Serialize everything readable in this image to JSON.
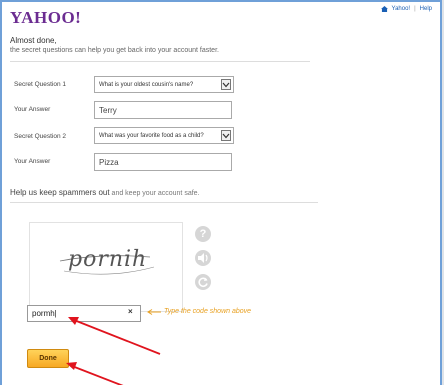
{
  "header": {
    "logo": "YAHOO!",
    "links": [
      "Yahoo!",
      "Help"
    ]
  },
  "intro": {
    "title": "Almost done,",
    "subtitle": "the secret questions can help you get back into your account faster."
  },
  "form": {
    "q1_label": "Secret Question 1",
    "q1_value": "What is your oldest cousin's name?",
    "a1_label": "Your Answer",
    "a1_value": "Terry",
    "q2_label": "Secret Question 2",
    "q2_value": "What was your favorite food as a child?",
    "a2_label": "Your Answer",
    "a2_value": "Pizza"
  },
  "spam": {
    "title": "Help us keep spammers out",
    "title_rest": " and keep your account safe."
  },
  "captcha": {
    "word": "pornih",
    "icons": [
      "help-icon",
      "audio-icon",
      "refresh-icon"
    ]
  },
  "code": {
    "value": "pormh|",
    "clear": "×",
    "hint": "Type the code shown above"
  },
  "done_label": "Done",
  "colors": {
    "logo": "#6b2c91",
    "hint": "#e8a020",
    "button": "#f7a823",
    "annotation_arrow": "#e0141e"
  }
}
